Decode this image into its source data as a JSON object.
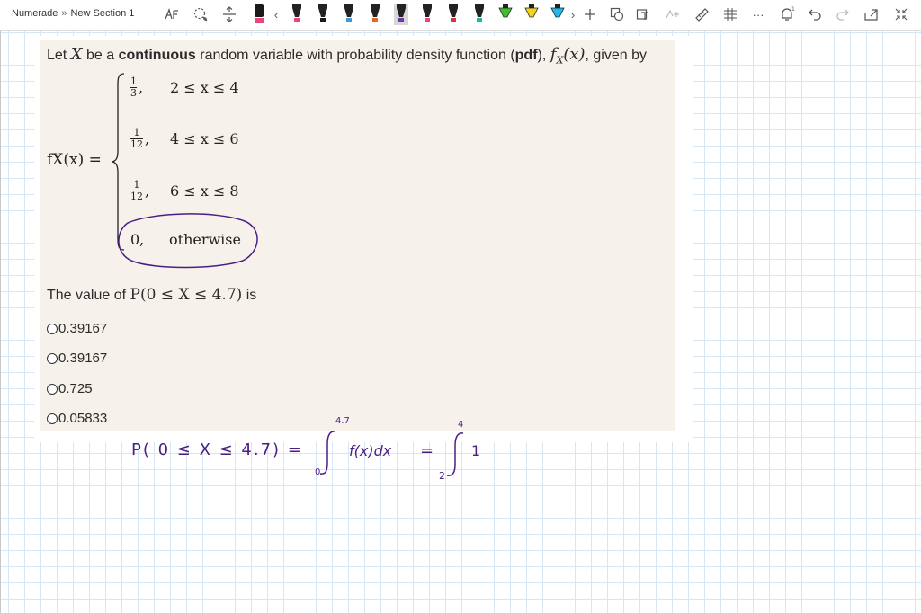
{
  "breadcrumb": {
    "app": "Numerade",
    "separator": "»",
    "section": "New Section 1"
  },
  "toolbar": {
    "nav_prev": "‹",
    "nav_next": "›",
    "more": "···",
    "pen_colors": [
      "#1a1a1a",
      "#e8467c",
      "#1a1a1a",
      "#3f97d6",
      "#e06b1c",
      "#6a3aa6",
      "#e8467c",
      "#d9333b",
      "#1bb5a0",
      "#3fbf2f",
      "#f5d21b",
      "#22b7e8"
    ]
  },
  "question": {
    "stem_prefix": "Let",
    "var": "X",
    "stem_mid": "be a",
    "stem_bold": "continuous",
    "stem_rest": "random variable with probability density function (",
    "pdf": "pdf",
    "stem_close": "),",
    "fx": "f",
    "fx_sub": "X",
    "fx_arg": "(x)",
    "stem_end": ", given by",
    "lhs": "fX(x) =",
    "pieces": [
      {
        "num": "1",
        "den": "3",
        "cond": "2 ≤ x ≤ 4"
      },
      {
        "num": "1",
        "den": "12",
        "cond": "4 ≤ x ≤ 6"
      },
      {
        "num": "1",
        "den": "12",
        "cond": "6 ≤ x ≤ 8"
      },
      {
        "value": "0,",
        "cond": "otherwise"
      }
    ],
    "prompt_prefix": "The value of",
    "prompt_math": "P(0 ≤ X ≤ 4.7)",
    "prompt_suffix": "is",
    "options": [
      "0.39167",
      "0.39167",
      "0.725",
      "0.05833"
    ]
  },
  "handwriting": {
    "line": "P( 0 ≤ X ≤ 4.7) =",
    "upper1": "4.7",
    "lower1": "0",
    "integrand": "f(x)dx",
    "equals": "=",
    "upper2": "4",
    "lower2": "2",
    "tail": "1"
  },
  "colors": {
    "ink": "#4b1e86",
    "card": "#f6f1ea",
    "grid": "#d6e6f3"
  }
}
